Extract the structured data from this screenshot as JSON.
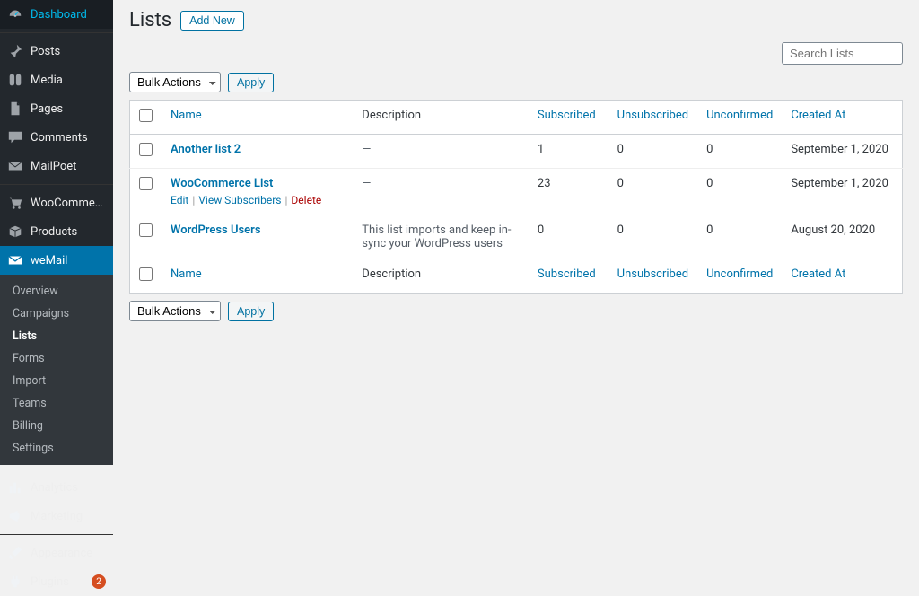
{
  "sidebar": {
    "items": [
      {
        "icon": "dash",
        "label": "Dashboard"
      },
      {
        "icon": "pin",
        "label": "Posts",
        "sepBefore": true
      },
      {
        "icon": "media",
        "label": "Media"
      },
      {
        "icon": "page",
        "label": "Pages"
      },
      {
        "icon": "comment",
        "label": "Comments"
      },
      {
        "icon": "mail",
        "label": "MailPoet"
      },
      {
        "icon": "cart",
        "label": "WooCommerce",
        "sepBefore": true
      },
      {
        "icon": "box",
        "label": "Products"
      },
      {
        "icon": "envelope",
        "label": "weMail",
        "current": true,
        "sub": [
          {
            "label": "Overview"
          },
          {
            "label": "Campaigns"
          },
          {
            "label": "Lists",
            "active": true
          },
          {
            "label": "Forms"
          },
          {
            "label": "Import"
          },
          {
            "label": "Teams"
          },
          {
            "label": "Billing"
          },
          {
            "label": "Settings"
          }
        ]
      },
      {
        "icon": "chart",
        "label": "Analytics",
        "sepBefore": true
      },
      {
        "icon": "mega",
        "label": "Marketing"
      },
      {
        "icon": "brush",
        "label": "Appearance",
        "sepBefore": true
      },
      {
        "icon": "plug",
        "label": "Plugins",
        "badge": "2"
      }
    ]
  },
  "page": {
    "title": "Lists",
    "add_new": "Add New",
    "search_placeholder": "Search Lists",
    "bulk_action": "Bulk Actions",
    "apply": "Apply"
  },
  "columns": {
    "name": "Name",
    "description": "Description",
    "subscribed": "Subscribed",
    "unsubscribed": "Unsubscribed",
    "unconfirmed": "Unconfirmed",
    "created": "Created At"
  },
  "row_actions": {
    "edit": "Edit",
    "view": "View Subscribers",
    "delete": "Delete"
  },
  "rows": [
    {
      "name": "Another list 2",
      "description": "—",
      "subscribed": "1",
      "unsubscribed": "0",
      "unconfirmed": "0",
      "created": "September 1, 2020",
      "hover": false
    },
    {
      "name": "WooCommerce List",
      "description": "—",
      "subscribed": "23",
      "unsubscribed": "0",
      "unconfirmed": "0",
      "created": "September 1, 2020",
      "hover": true
    },
    {
      "name": "WordPress Users",
      "description": "This list imports and keep in-sync your WordPress users",
      "subscribed": "0",
      "unsubscribed": "0",
      "unconfirmed": "0",
      "created": "August 20, 2020",
      "hover": false
    }
  ]
}
